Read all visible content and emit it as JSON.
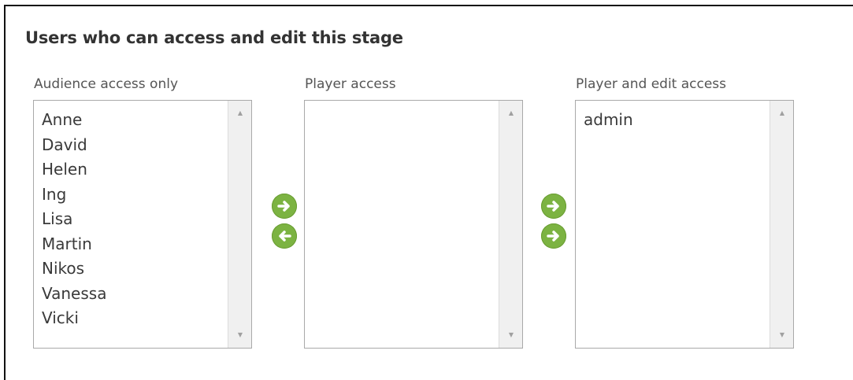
{
  "section": {
    "title": "Users who can access and edit this stage"
  },
  "lists": {
    "audience": {
      "label": "Audience access only",
      "items": [
        "Anne",
        "David",
        "Helen",
        "Ing",
        "Lisa",
        "Martin",
        "Nikos",
        "Vanessa",
        "Vicki"
      ]
    },
    "player": {
      "label": "Player access",
      "items": []
    },
    "player_edit": {
      "label": "Player and edit access",
      "items": [
        "admin"
      ]
    }
  },
  "buttons": {
    "audience_to_player": {
      "icon": "arrow-right-icon",
      "color": "#7cb342"
    },
    "player_to_audience": {
      "icon": "arrow-left-icon",
      "color": "#7cb342"
    },
    "player_to_edit": {
      "icon": "arrow-right-icon",
      "color": "#7cb342"
    },
    "edit_to_player": {
      "icon": "arrow-left-icon",
      "color": "#7cb342"
    }
  },
  "icons": {
    "scroll_up": "scroll-up-icon",
    "scroll_down": "scroll-down-icon"
  }
}
